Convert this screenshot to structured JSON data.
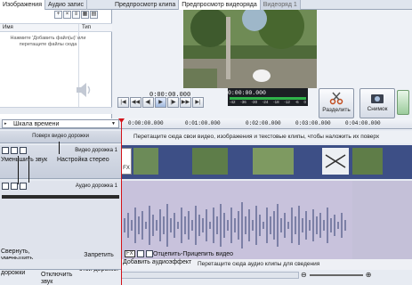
{
  "collections": {
    "tabs": [
      "Изображения",
      "Аудио запис"
    ],
    "columns": {
      "name": "Имя",
      "type": "Тип"
    },
    "hint": "Нажмите 'Добавить файл(ы)' или перетащите файлы сюда"
  },
  "preview": {
    "tabs": [
      "Предпросмотр клипа",
      "Предпросмотр видеоряда",
      "Видеоряд 1"
    ],
    "timecode": "0:00:00.000",
    "timecode_total": "0:00:00.000",
    "meter_scale": [
      "-42",
      "-36",
      "-30",
      "-24",
      "-18",
      "-12",
      "-6",
      "0"
    ],
    "split_label": "Разделить",
    "snapshot_label": "Снимок"
  },
  "timeline": {
    "title": "Шкала времени",
    "ruler": [
      "0:00:00.000",
      "0:01:00.000",
      "0:02:00.000",
      "0:03:00.000",
      "0:04:00.000",
      "0:05:00.000"
    ],
    "overlay_hint": "Поверх видео дорожки",
    "overlay_drop": "Перетащите сюда свои видео, изображения и текстовые клипы, чтобы наложить их поверх",
    "video_track": "Видео дорожка 1",
    "audio_track": "Аудио дорожка 1",
    "audio_drop": "Перетащите сюда аудио клипы для сведения",
    "clip_fx": "FX"
  },
  "annotations": {
    "reduce_sound": "Уменьшить звук",
    "stereo_settings": "Настройка стерео",
    "collapse": "Свернуть, уменьшить ширину дорожки",
    "mute": "Отключить звук",
    "lock": "Запретить редактирование этой дорожки",
    "unlink": "Отцепить-Прицепить видео",
    "add_audio_fx": "Добавить аудиоэффект"
  }
}
